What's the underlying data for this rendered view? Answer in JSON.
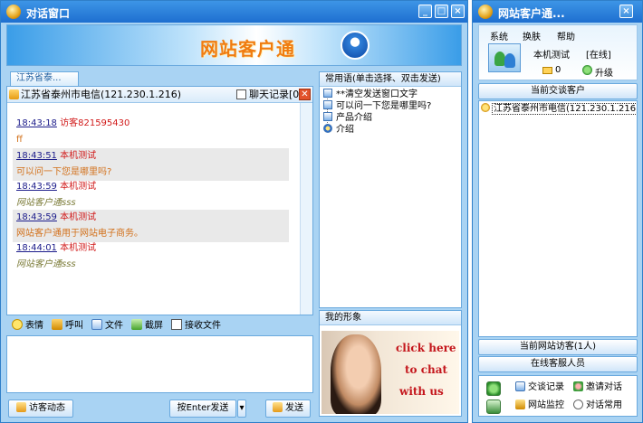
{
  "chat_window": {
    "title": "对话窗口",
    "banner_title": "网站客户通",
    "tab_label": "江苏省泰...",
    "header_location": "江苏省泰州市电信(121.230.1.216)",
    "chat_log_label": "聊天记录[0]",
    "close_symbol": "✕",
    "messages": [
      {
        "time": "18:43:18",
        "sender": "访客821595430",
        "text": "ff"
      },
      {
        "time": "18:43:51",
        "sender": "本机测试",
        "text": "可以问一下您是哪里吗?"
      },
      {
        "time": "18:43:59",
        "sender": "本机测试",
        "text": "网站客户通sss"
      },
      {
        "time": "18:43:59",
        "sender": "本机测试",
        "text": "网站客户通用于网站电子商务。"
      },
      {
        "time": "18:44:01",
        "sender": "本机测试",
        "text": "网站客户通sss"
      }
    ],
    "toolbar": {
      "emoji": "表情",
      "call": "呼叫",
      "file": "文件",
      "screenshot": "截屏",
      "receive_file": "接收文件"
    },
    "visitor_activity_button": "访客动态",
    "send_mode_button": "按Enter发送",
    "send_button": "发送",
    "phrases": {
      "header": "常用语(单击选择、双击发送)",
      "items": [
        "**清空发送窗口文字",
        "可以问一下您是哪里吗?",
        "产品介绍",
        "介绍"
      ]
    },
    "image_panel": {
      "header": "我的形象",
      "ad_lines": [
        "click here",
        "to chat",
        "with us"
      ]
    },
    "window_buttons": [
      "_",
      "□",
      "×"
    ]
  },
  "client_window": {
    "title": "网站客户通...",
    "menu": [
      "系统",
      "换肤",
      "帮助"
    ],
    "user_name": "本机测试",
    "status": "[在线]",
    "mail_count": "0",
    "upgrade": "升级",
    "current_visitors_label": "当前交谈客户",
    "visitor_entry": "江苏省泰州市电信(121.230.1.216)",
    "site_visitors_label": "当前网站访客(1人)",
    "online_staff_label": "在线客服人员",
    "links": {
      "chat_log": "交谈记录",
      "invite": "邀请对话",
      "monitor": "网站监控",
      "phrases": "对话常用"
    },
    "close_symbol": "×"
  }
}
